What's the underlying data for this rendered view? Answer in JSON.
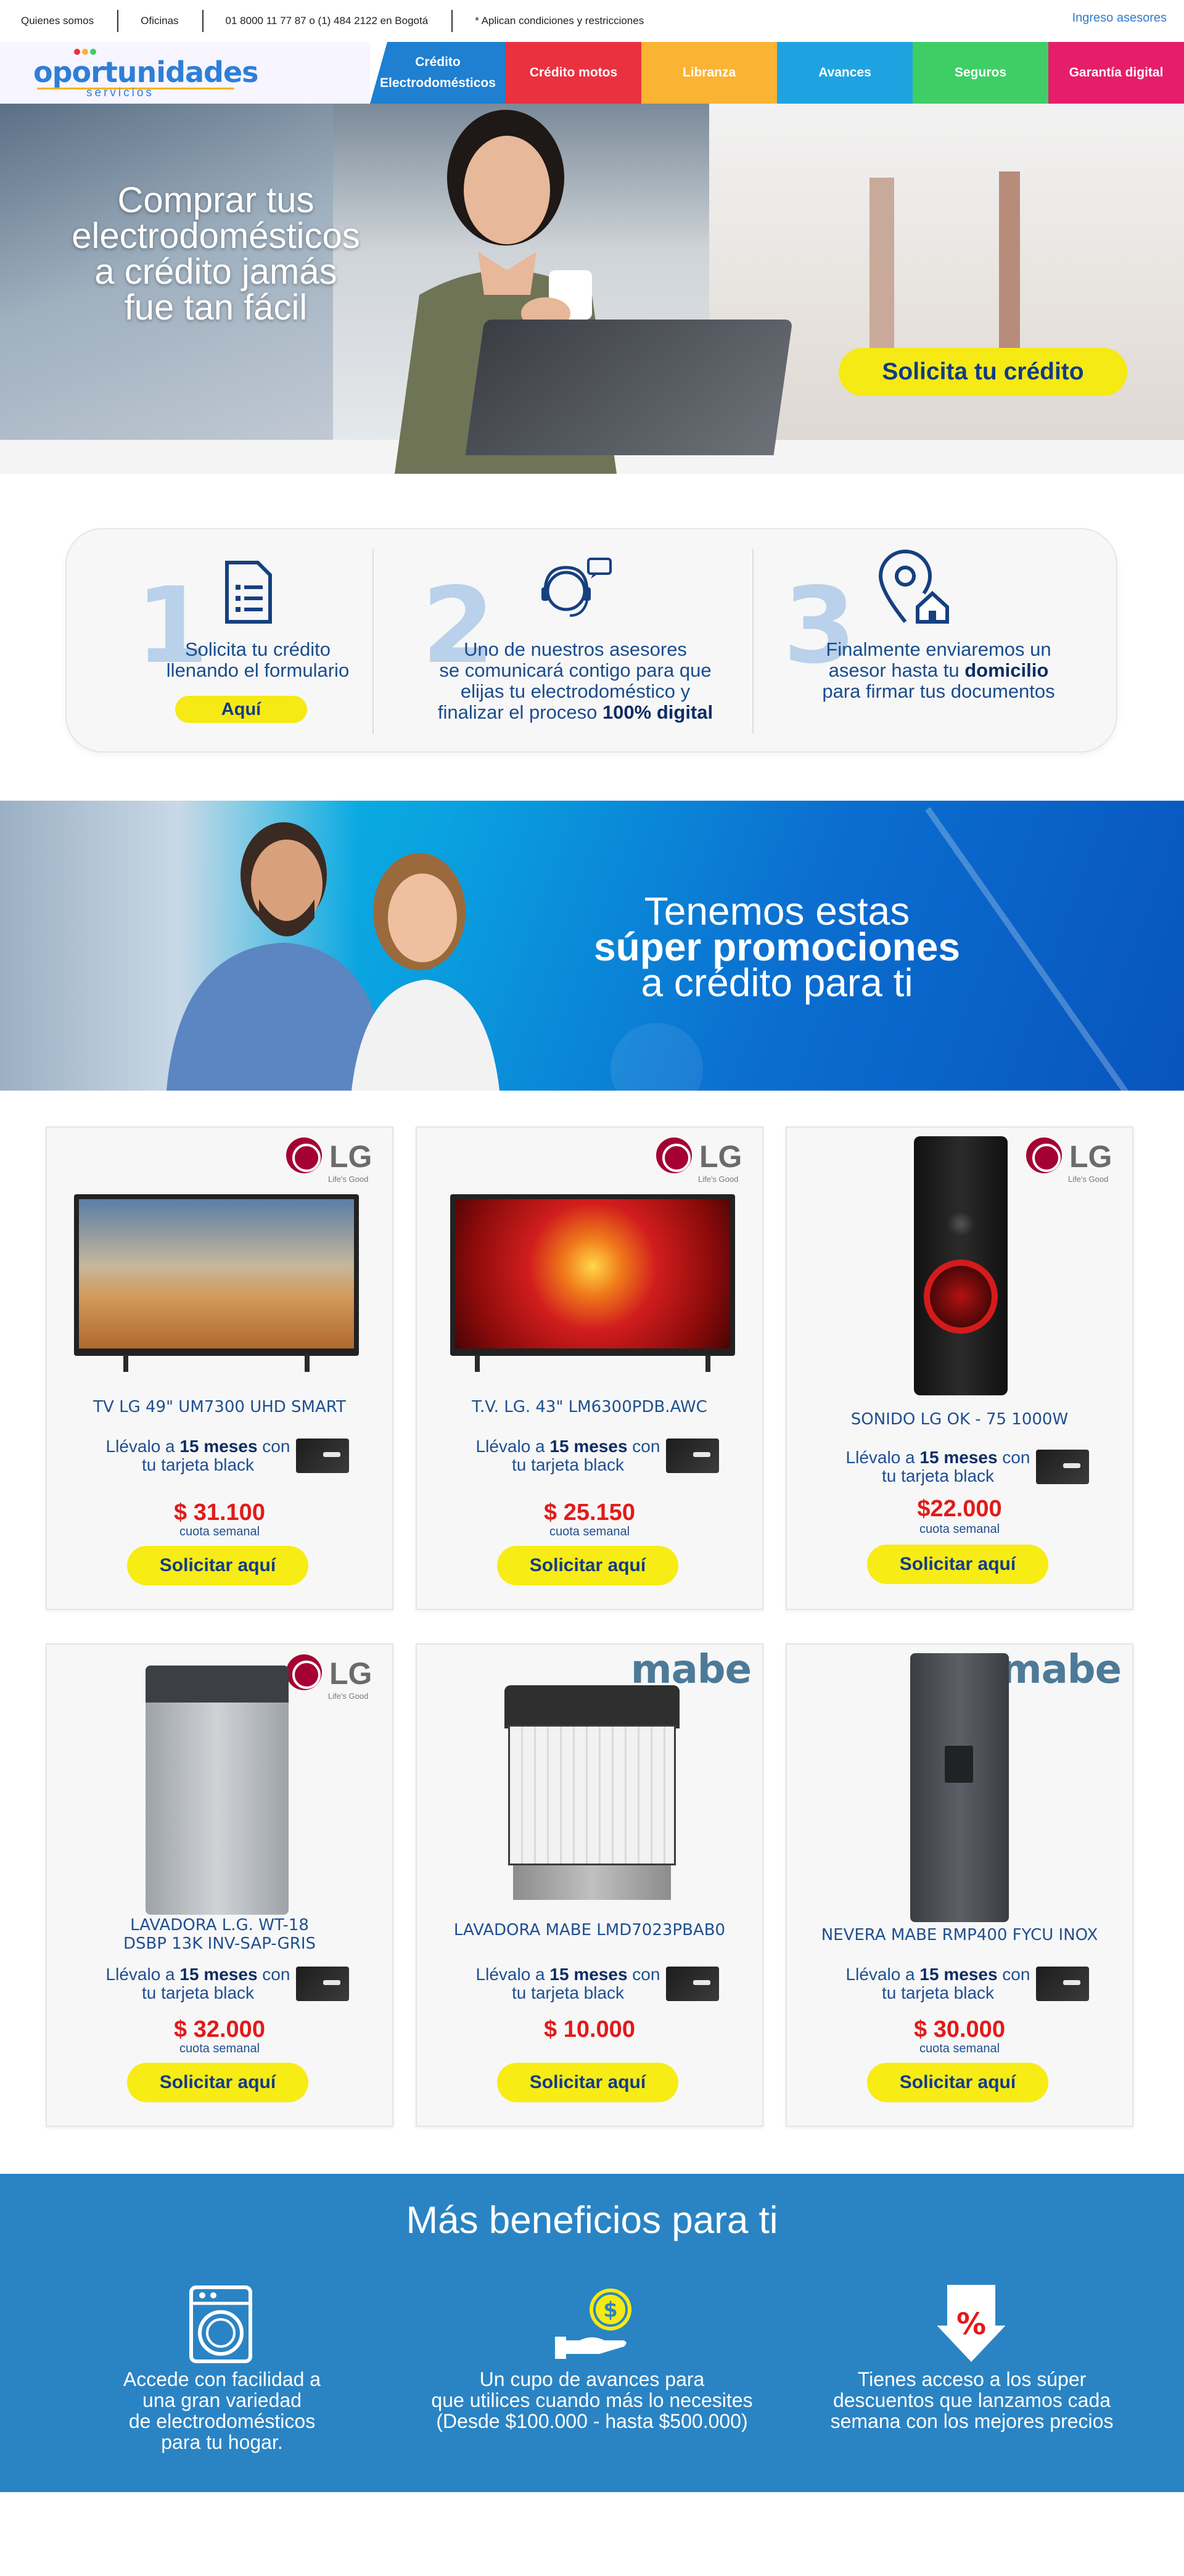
{
  "topbar": {
    "links": [
      "Quienes somos",
      "Oficinas",
      "01 8000 11 77 87 o (1) 484 2122 en Bogotá",
      "* Aplican condiciones y restricciones"
    ],
    "asesores": "Ingreso asesores"
  },
  "logo": {
    "word": "oportunidades",
    "sub": "servicios"
  },
  "nav": {
    "tabs": [
      {
        "label_line1": "Crédito",
        "label_line2": "Electrodomésticos",
        "color": "#1f7fd0"
      },
      {
        "label_line1": "Crédito motos",
        "label_line2": "",
        "color": "#ea3140"
      },
      {
        "label_line1": "Libranza",
        "label_line2": "",
        "color": "#fbb334"
      },
      {
        "label_line1": "Avances",
        "label_line2": "",
        "color": "#1fa3e0"
      },
      {
        "label_line1": "Seguros",
        "label_line2": "",
        "color": "#3fce65"
      },
      {
        "label_line1": "Garantía digital",
        "label_line2": "",
        "color": "#e51d6b"
      }
    ]
  },
  "hero": {
    "title_lines": [
      "Comprar tus",
      "electrodomésticos",
      "a crédito jamás",
      "fue tan fácil"
    ],
    "cta": "Solicita tu crédito"
  },
  "steps": [
    {
      "number": "1",
      "lines": [
        "Solicita tu crédito",
        "llenando el formulario"
      ],
      "button": "Aquí",
      "icon": "form-icon"
    },
    {
      "number": "2",
      "lines": [
        "Uno de nuestros asesores",
        "se comunicará contigo para que",
        "elijas tu electrodoméstico y"
      ],
      "last_line_prefix": "finalizar el proceso ",
      "last_line_bold": "100% digital",
      "icon": "agent-icon"
    },
    {
      "number": "3",
      "lines": [
        "Finalmente enviaremos un"
      ],
      "line2_prefix": "asesor hasta tu ",
      "line2_bold": "domicilio",
      "line3": "para firmar tus documentos",
      "icon": "home-location-icon"
    }
  ],
  "promo": {
    "line1": "Tenemos estas",
    "line2": "súper promociones",
    "line3": "a crédito para ti"
  },
  "offer": {
    "prefix": "Llévalo a ",
    "bold": "15 meses",
    "suffix": " con",
    "line2": "tu tarjeta black",
    "cuota": "cuota semanal",
    "button": "Solicitar aquí"
  },
  "products": [
    {
      "name": "TV LG 49\" UM7300 UHD SMART",
      "name2": "",
      "price": "$ 31.100",
      "brand": "LG",
      "brand_sub": "Life's Good",
      "show_cuota": true
    },
    {
      "name": "T.V. LG. 43\" LM6300PDB.AWC",
      "name2": "",
      "price": "$ 25.150",
      "brand": "LG",
      "brand_sub": "Life's Good",
      "show_cuota": true
    },
    {
      "name": "SONIDO LG OK - 75 1000W",
      "name2": "",
      "price": "$22.000",
      "brand": "LG",
      "brand_sub": "Life's Good",
      "show_cuota": true
    },
    {
      "name": "LAVADORA L.G. WT-18",
      "name2": "DSBP 13K INV-SAP-GRIS",
      "price": "$ 32.000",
      "brand": "LG",
      "brand_sub": "Life's Good",
      "show_cuota": true
    },
    {
      "name": "LAVADORA MABE LMD7023PBAB0",
      "name2": "",
      "price": "$ 10.000",
      "brand": "mabe",
      "brand_sub": "",
      "show_cuota": false
    },
    {
      "name": "NEVERA MABE RMP400 FYCU INOX",
      "name2": "",
      "price": "$ 30.000",
      "brand": "mabe",
      "brand_sub": "",
      "show_cuota": true
    }
  ],
  "benefits": {
    "title": "Más beneficios para ti",
    "items": [
      {
        "lines": [
          "Accede con facilidad a",
          "una gran variedad",
          "de electrodomésticos",
          "para tu hogar."
        ],
        "icon": "washing-machine-icon"
      },
      {
        "lines": [
          "Un cupo de avances para",
          "que utilices cuando más lo necesites",
          "(Desde $100.000 - hasta $500.000)"
        ],
        "icon": "money-hand-icon"
      },
      {
        "lines": [
          "Tienes acceso a los súper",
          "descuentos que lanzamos cada",
          "semana con los mejores precios"
        ],
        "icon": "discount-arrow-icon"
      }
    ]
  }
}
